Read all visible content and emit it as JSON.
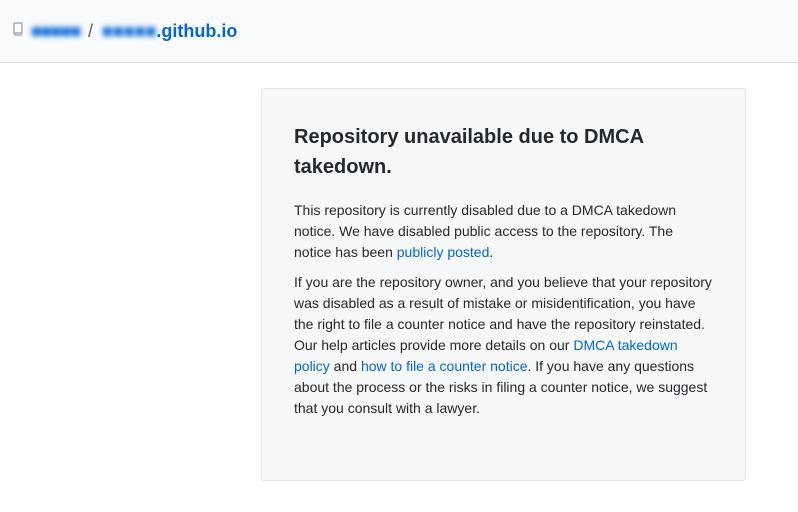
{
  "header": {
    "owner": "■■■■■",
    "separator": "/",
    "repo_blurred": "■■■■■",
    "repo_suffix": ".github.io",
    "repo_icon": "repo-icon"
  },
  "notice": {
    "title": "Repository unavailable due to DMCA takedown.",
    "p1_text": "This repository is currently disabled due to a DMCA takedown notice. We have disabled public access to the repository. The notice has been ",
    "p1_link": "publicly posted",
    "p1_end": ".",
    "p2_text_a": "If you are the repository owner, and you believe that your repository was disabled as a result of mistake or misidentification, you have the right to file a counter notice and have the repository reinstated. Our help articles provide more details on our ",
    "p2_link1": "DMCA takedown policy",
    "p2_text_b": " and ",
    "p2_link2": "how to file a counter notice",
    "p2_text_c": ". If you have any questions about the process or the risks in filing a counter notice, we suggest that you consult with a lawyer."
  },
  "colors": {
    "link": "#0366d6",
    "text": "#24292e",
    "card_bg": "#f6f8fa",
    "border": "#e1e4e8"
  }
}
